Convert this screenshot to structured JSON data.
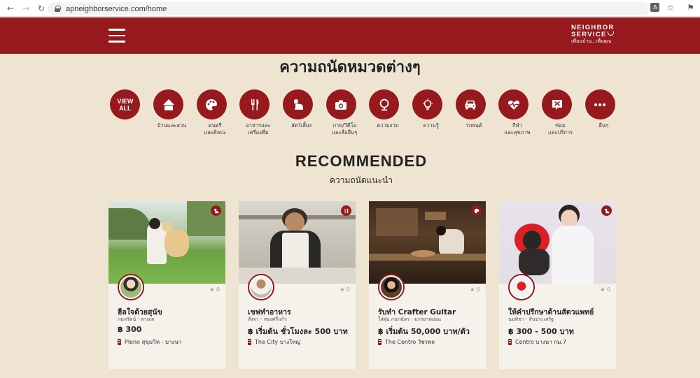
{
  "browser": {
    "url": "apneighborservice.com/home"
  },
  "header": {
    "logo_line1": "NEIGHBOR",
    "logo_line2": "SERVICE",
    "logo_tagline": "เพื่อนบ้าน...เพื่อคุณ"
  },
  "section_title": "ความถนัดหมวดต่างๆ",
  "categories": [
    {
      "label": "VIEW\nALL",
      "icon": "view-all"
    },
    {
      "label": "บ้านและสวน",
      "icon": "house-icon"
    },
    {
      "label": "ดนตรี\nและศิลปะ",
      "icon": "palette-icon"
    },
    {
      "label": "อาหารและ\nเครื่องดื่ม",
      "icon": "utensils-icon"
    },
    {
      "label": "สัตว์เลี้ยง",
      "icon": "dog-icon"
    },
    {
      "label": "ภาพ/วีดีโอ\nและสื่ออื่นๆ",
      "icon": "camera-icon"
    },
    {
      "label": "ความงาม",
      "icon": "mirror-icon"
    },
    {
      "label": "ความรู้",
      "icon": "lightbulb-icon"
    },
    {
      "label": "รถยนต์",
      "icon": "car-icon"
    },
    {
      "label": "กีฬา\nและสุขภาพ",
      "icon": "heartbeat-icon"
    },
    {
      "label": "ซ่อม\nและบริการ",
      "icon": "tools-icon"
    },
    {
      "label": "อื่นๆ",
      "icon": "more-icon"
    }
  ],
  "recommended": {
    "title": "RECOMMENDED",
    "subtitle": "ความถนัดแนะนำ"
  },
  "cards": [
    {
      "title": "ฮีลใจด้วยสุนัข",
      "owner": "กมลรัตน์ - ลาเอล",
      "price": "฿ 300",
      "location": "Pleno สุขุมวิท - บางนา",
      "rating": "0",
      "badge": "dog-icon"
    },
    {
      "title": "เชฟทำอาหาร",
      "owner": "สังจา - ทองศรีแก้ว",
      "price": "฿ เริ่มต้น ชั่วโมงละ 500 บาท",
      "location": "The City บางใหญ่",
      "rating": "0",
      "badge": "utensils-icon"
    },
    {
      "title": "รับทำ Crafter Guitar",
      "owner": "ใส่ฝุ่น กนกฉัตร - มรรยาทอ่อน",
      "price": "฿ เริ่มต้น 50,000 บาท/ตัว",
      "location": "The Centro วัชรพล",
      "rating": "0",
      "badge": "palette-icon"
    },
    {
      "title": "ให้คำปรึกษาด้านสัตวแพทย์",
      "owner": "นมทิชา - สินประเสริฐ",
      "price": "฿ 300 - 500 บาท",
      "location": "Centro บางนา กม.7",
      "rating": "0",
      "badge": "dog-icon"
    }
  ],
  "colors": {
    "brand": "#96191e",
    "background": "#efe4d2"
  }
}
